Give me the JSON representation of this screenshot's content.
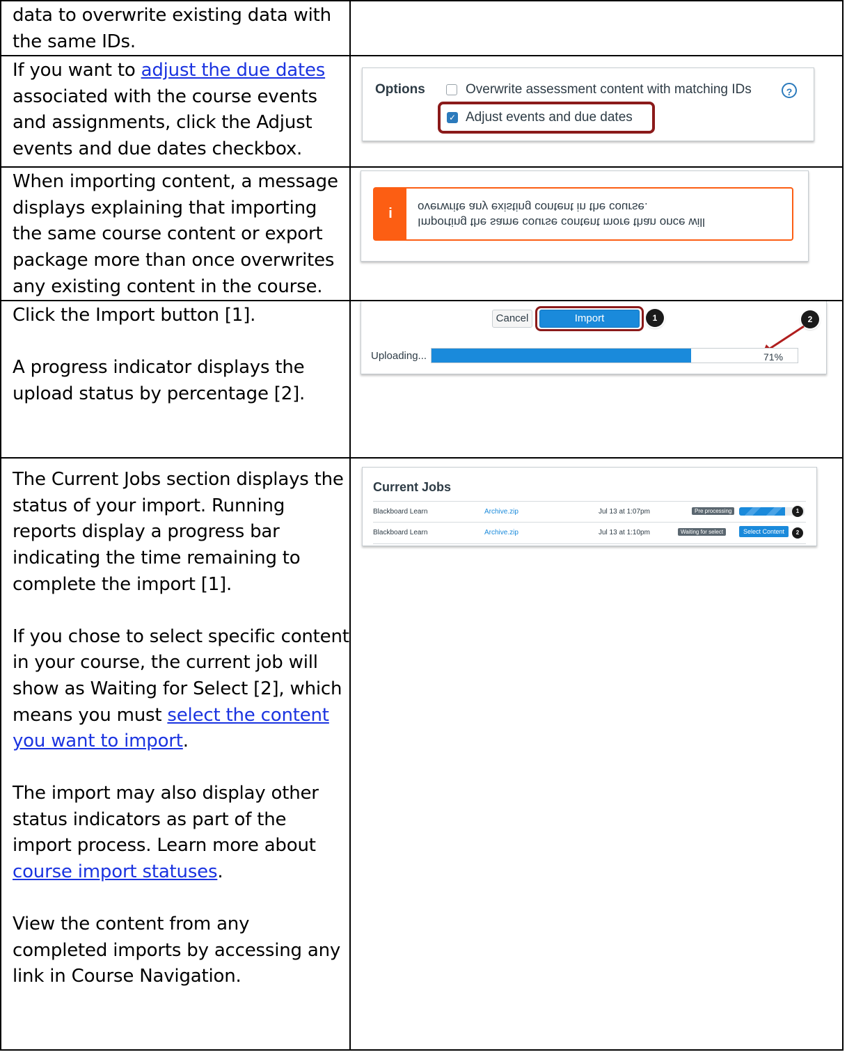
{
  "rows": {
    "r0": {
      "text": "data to overwrite existing data with the same IDs."
    },
    "r1": {
      "before": "If you want to ",
      "link": "adjust the due dates",
      "middle": " associated with the course events and assignments, click the ",
      "bold": "Adjust events and due dates",
      "after": " checkbox."
    },
    "r2": {
      "text": "When importing content, a message displays explaining that importing the same course content or export package more than once overwrites any existing content in the course."
    },
    "r3": {
      "a_before": "Click the ",
      "a_bold": "Import",
      "a_after": " button [1].",
      "b": "A progress indicator displays the upload status by percentage [2]."
    },
    "r4": {
      "p1": "The Current Jobs section displays the status of your import. Running reports display a progress bar indicating the time remaining to complete the import [1].",
      "p2_before": "If you chose to select specific content in your course, the current job will show as Waiting for Select [2], which means you must ",
      "p2_link": "select the content you want to import",
      "p2_after": ".",
      "p3_before": "The import may also display other status indicators as part of the import process. Learn more about ",
      "p3_link": "course import statuses",
      "p3_after": ".",
      "p4": "View the content from any completed imports by accessing any link in Course Navigation."
    }
  },
  "options_shot": {
    "title": "Options",
    "opt1": "Overwrite assessment content with matching IDs",
    "opt1_checked": false,
    "opt2": "Adjust events and due dates",
    "opt2_checked": true,
    "help_glyph": "?",
    "check_glyph": "✓"
  },
  "alert_shot": {
    "icon_glyph": "i",
    "line1": "Importing the same course content more than once will",
    "line2": "overwrite any existing content in the course."
  },
  "import_shot": {
    "cancel": "Cancel",
    "import": "Import",
    "badge1": "1",
    "badge2": "2",
    "uploading": "Uploading...",
    "progress": 0.71,
    "percent": "71%"
  },
  "jobs_shot": {
    "title": "Current Jobs",
    "rows": [
      {
        "source": "Blackboard Learn",
        "file": "Archive.zip",
        "date": "Jul 13 at 1:07pm",
        "status": "Pre processing",
        "progress": 0.7,
        "badge": "1"
      },
      {
        "source": "Blackboard Learn",
        "file": "Archive.zip",
        "date": "Jul 13 at 1:10pm",
        "status": "Waiting for select",
        "action": "Select Content",
        "badge": "2"
      }
    ]
  },
  "colors": {
    "highlight": "#8b1a1a",
    "primary": "#1a8adb",
    "alert": "#fc5e13",
    "link": "#1a33e0"
  }
}
